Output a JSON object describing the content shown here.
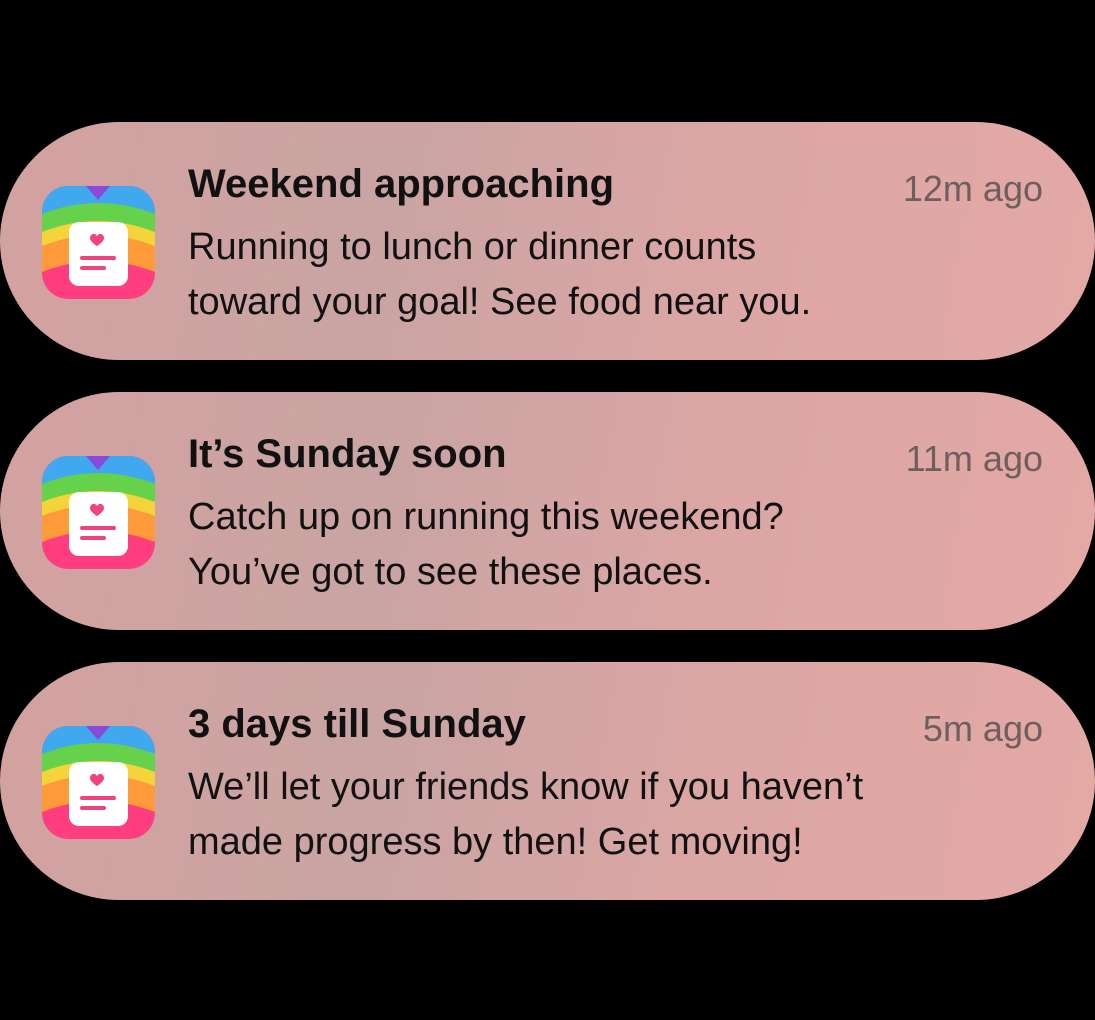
{
  "notifications": [
    {
      "app_icon": "rainbow-journal-heart-icon",
      "title": "Weekend approaching",
      "time": "12m ago",
      "body_lines": [
        "Running to lunch or dinner counts",
        "toward your goal! See food near you."
      ]
    },
    {
      "app_icon": "rainbow-journal-heart-icon",
      "title": "It’s Sunday soon",
      "time": "11m ago",
      "body_lines": [
        "Catch up on running this weekend?",
        "You’ve got to see these places."
      ]
    },
    {
      "app_icon": "rainbow-journal-heart-icon",
      "title": "3 days till Sunday",
      "time": "5m ago",
      "body_lines": [
        "We’ll let your friends know if you haven’t",
        "made progress by then! Get moving!"
      ]
    }
  ],
  "colors": {
    "background": "#000000",
    "card": "#d3a3a2",
    "title_text": "#111111",
    "time_text": "#6e5e5e",
    "icon_heart": "#f0457a"
  }
}
